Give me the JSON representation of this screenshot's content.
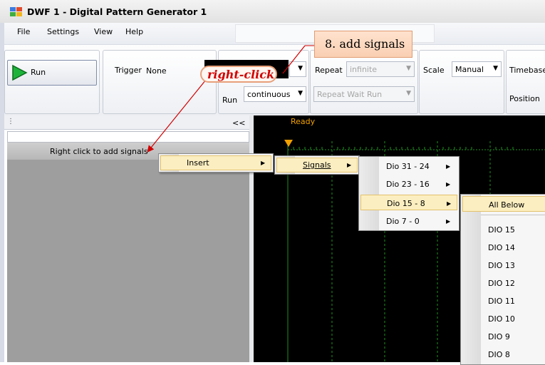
{
  "window": {
    "title": "DWF 1 - Digital Pattern Generator 1"
  },
  "menu": [
    "File",
    "Settings",
    "View",
    "Help"
  ],
  "toolbar": {
    "run_label": "Run",
    "trigger_label": "Trigger",
    "trigger_value": "None",
    "repeat_label": "Repeat",
    "repeat_value": "infinite",
    "run_mode_label": "Run",
    "run_mode_value": "continuous",
    "repeat_wait_value": "Repeat Wait Run",
    "scale_label": "Scale",
    "scale_value": "Manual",
    "timebase_label": "Timebase",
    "position_label": "Position"
  },
  "left_panel": {
    "collapse_label": "<<",
    "hint": "Right click to add signals"
  },
  "plot": {
    "status": "Ready"
  },
  "context_menu": {
    "insert": "Insert",
    "signals": "Signals",
    "groups": [
      "Dio 31 - 24",
      "Dio 23 - 16",
      "Dio 15 - 8",
      "Dio 7 - 0"
    ],
    "all_below": "All Below",
    "dio_items": [
      "DIO 15",
      "DIO 14",
      "DIO 13",
      "DIO 12",
      "DIO 11",
      "DIO 10",
      "DIO 9",
      "DIO 8"
    ]
  },
  "annotations": {
    "step": "8. add signals",
    "right_click": "right-click"
  },
  "colors": {
    "accent_red": "#d10000",
    "callout_fill": "#fbd6bd",
    "plot_grid": "#1f8f1f",
    "trigger_marker": "#f0a000",
    "menu_highlight": "#fbeec0"
  }
}
